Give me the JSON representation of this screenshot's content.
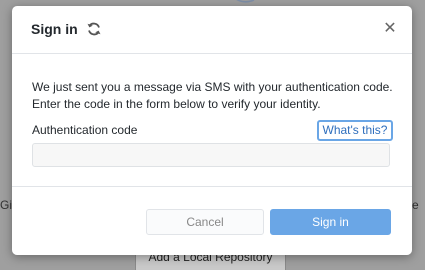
{
  "background": {
    "left_text": "Git",
    "right_text": "e",
    "button_label": "Add a Local Repository"
  },
  "dialog": {
    "title": "Sign in",
    "title_icon": "sync-icon",
    "close_icon": "close-icon",
    "close_glyph": "✕",
    "message": "We just sent you a message via SMS with your authentication code. Enter the code in the form below to verify your identity.",
    "field_label": "Authentication code",
    "help_link": "What's this?",
    "code_value": "",
    "cancel_label": "Cancel",
    "submit_label": "Sign in"
  },
  "colors": {
    "primary": "#6aa6e6",
    "link": "#2f6fbd",
    "overlay": "#a4a4a4"
  }
}
